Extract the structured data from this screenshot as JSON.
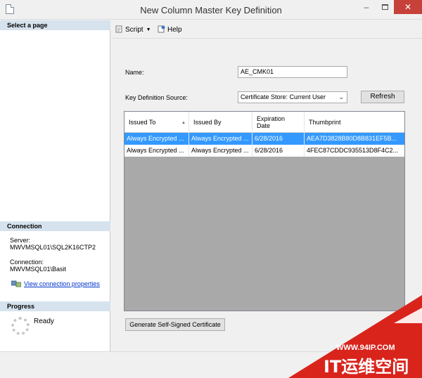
{
  "window": {
    "title": "New Column Master Key Definition",
    "minimize_glyph": "–",
    "close_glyph": "✕"
  },
  "left": {
    "select_page_header": "Select a page",
    "connection_header": "Connection",
    "server_label": "Server:",
    "server_value": "MWVMSQL01\\SQL2K16CTP2",
    "connection_label": "Connection:",
    "connection_value": "MWVMSQL01\\Basit",
    "view_props_link": "View connection properties",
    "progress_header": "Progress",
    "progress_status": "Ready"
  },
  "toolbar": {
    "script_label": "Script",
    "help_label": "Help"
  },
  "form": {
    "name_label": "Name:",
    "name_value": "AE_CMK01",
    "source_label": "Key Definition Source:",
    "source_value": "Certificate Store: Current User",
    "refresh_label": "Refresh",
    "generate_label": "Generate Self-Signed Certificate"
  },
  "grid": {
    "columns": [
      {
        "label": "Issued To"
      },
      {
        "label": "Issued By"
      },
      {
        "label": "Expiration Date"
      },
      {
        "label": "Thumbprint"
      }
    ],
    "rows": [
      {
        "issued_to": "Always Encrypted ...",
        "issued_by": "Always Encrypted ...",
        "expiration": "6/28/2016",
        "thumbprint": "AEA7D3828B80D8B831EF5B...",
        "selected": true
      },
      {
        "issued_to": "Always Encrypted ...",
        "issued_by": "Always Encrypted ...",
        "expiration": "6/28/2016",
        "thumbprint": "4FEC87CDDC935513D8F4C2...",
        "selected": false
      }
    ]
  },
  "watermark": {
    "url": "WWW.94IP.COM",
    "brand": "IT运维空间"
  },
  "colors": {
    "selection": "#3399ff",
    "close_button": "#c7413b",
    "watermark_red": "#d9241c"
  }
}
